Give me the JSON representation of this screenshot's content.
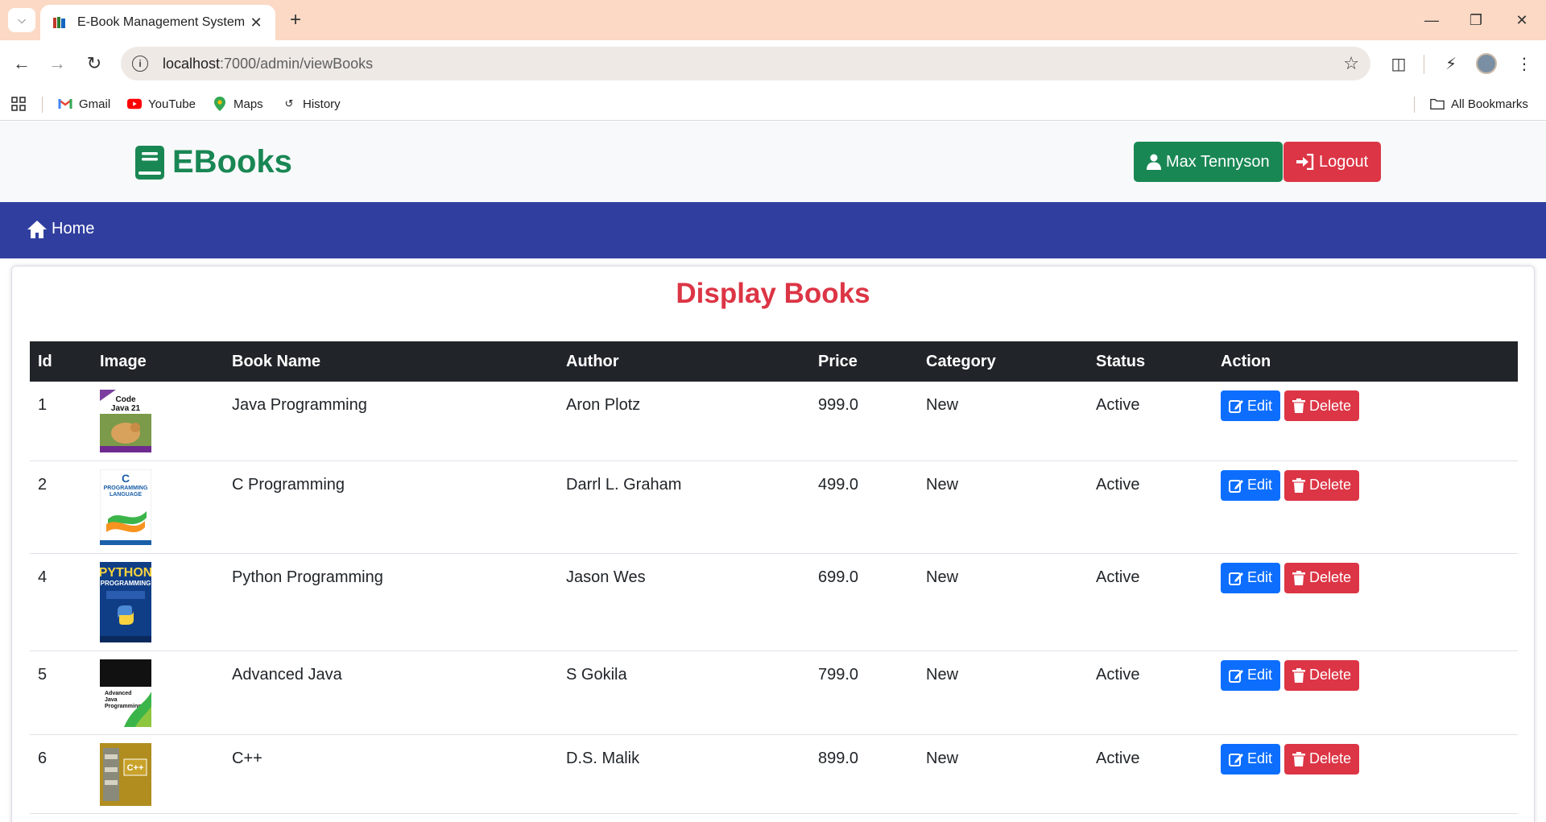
{
  "browser": {
    "tab_title": "E-Book Management System",
    "url_host": "localhost",
    "url_rest": ":7000/admin/viewBooks",
    "bookmarks": [
      "Gmail",
      "YouTube",
      "Maps",
      "History"
    ],
    "all_bookmarks": "All Bookmarks"
  },
  "header": {
    "brand": "EBooks",
    "user_name": "Max Tennyson",
    "logout_label": "Logout"
  },
  "nav": {
    "home_label": "Home"
  },
  "page": {
    "title": "Display Books",
    "columns": [
      "Id",
      "Image",
      "Book Name",
      "Author",
      "Price",
      "Category",
      "Status",
      "Action"
    ],
    "edit_label": "Edit",
    "delete_label": "Delete",
    "rows": [
      {
        "id": "1",
        "name": "Java Programming",
        "author": "Aron Plotz",
        "price": "999.0",
        "category": "New",
        "status": "Active",
        "cover_text": "Code Java 21",
        "cover_color": "#7b9a4a"
      },
      {
        "id": "2",
        "name": "C Programming",
        "author": "Darrl L. Graham",
        "price": "499.0",
        "category": "New",
        "status": "Active",
        "cover_text": "C PROGRAMMING LANGUAGE",
        "cover_color": "#ffffff"
      },
      {
        "id": "4",
        "name": "Python Programming",
        "author": "Jason Wes",
        "price": "699.0",
        "category": "New",
        "status": "Active",
        "cover_text": "PYTHON PROGRAMMING",
        "cover_color": "#0f3d86"
      },
      {
        "id": "5",
        "name": "Advanced Java",
        "author": "S Gokila",
        "price": "799.0",
        "category": "New",
        "status": "Active",
        "cover_text": "Advanced Java Programming",
        "cover_color": "#111111"
      },
      {
        "id": "6",
        "name": "C++",
        "author": "D.S. Malik",
        "price": "899.0",
        "category": "New",
        "status": "Active",
        "cover_text": "C++",
        "cover_color": "#b08d1e"
      }
    ]
  },
  "colors": {
    "success": "#198754",
    "danger": "#dc3545",
    "primary": "#0d6efd",
    "navbar": "#303f9f",
    "table_head": "#212529"
  }
}
